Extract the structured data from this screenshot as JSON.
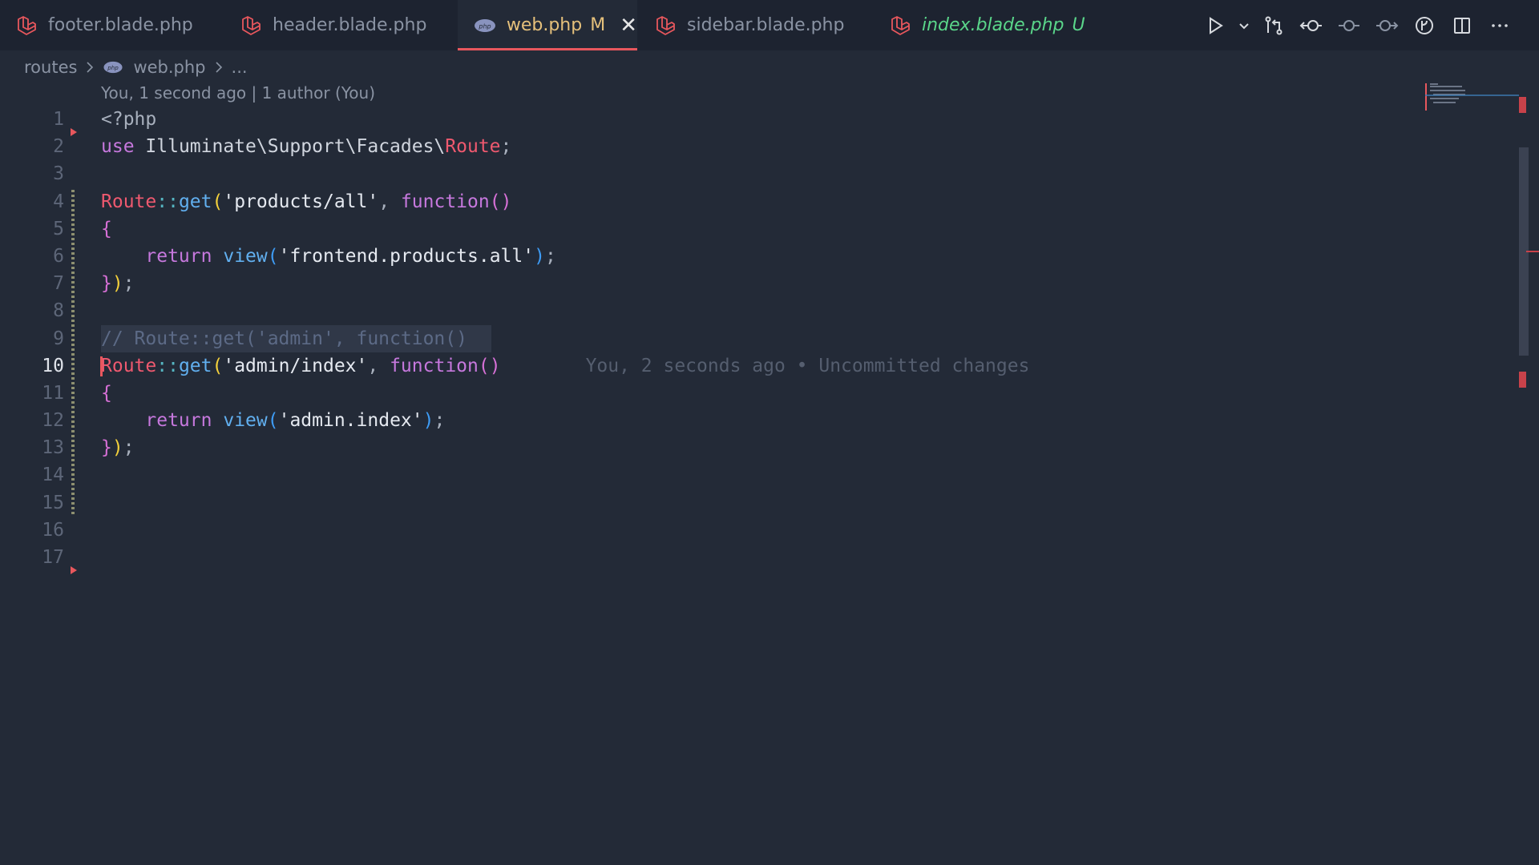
{
  "tabs": [
    {
      "name": "footer.blade.php",
      "status": "",
      "kind": "blade"
    },
    {
      "name": "header.blade.php",
      "status": "",
      "kind": "blade"
    },
    {
      "name": "web.php",
      "status": "M",
      "kind": "php",
      "active": true,
      "close": "✕"
    },
    {
      "name": "sidebar.blade.php",
      "status": "",
      "kind": "blade"
    },
    {
      "name": "index.blade.php",
      "status": "U",
      "kind": "blade"
    }
  ],
  "toolbar": {
    "icons": [
      "run-icon",
      "run-dropdown-icon",
      "source-control-compare-icon",
      "go-back-icon",
      "timeline-icon",
      "go-forward-icon",
      "gitlens-icon",
      "split-editor-icon",
      "more-actions-icon"
    ]
  },
  "breadcrumb": {
    "folder": "routes",
    "file": "web.php",
    "symbol": "..."
  },
  "editor": {
    "blame_header": "You, 1 second ago | 1 author (You)",
    "current_line": 10,
    "line_numbers": [
      "1",
      "2",
      "3",
      "4",
      "5",
      "6",
      "7",
      "8",
      "9",
      "10",
      "11",
      "12",
      "13",
      "14",
      "15",
      "16",
      "17"
    ],
    "code": {
      "l1": "<?php",
      "l2_kw": "use",
      "l2_ns": "Illuminate\\Support\\Facades\\",
      "l2_cls": "Route",
      "l2_end": ";",
      "l4_cls": "Route",
      "l4_op": "::",
      "l4_fn": "get",
      "l4_str": "'products/all'",
      "l4_func": "function",
      "l5": "{",
      "l6_ret": "return",
      "l6_fn": "view",
      "l6_str": "'frontend.products.all'",
      "l7": "});",
      "l9_comment": "// Route::get('admin', function()",
      "l10_cls": "Route",
      "l10_op": "::",
      "l10_fn": "get",
      "l10_str": "'admin/index'",
      "l10_func": "function",
      "l10_blame": "You, 2 seconds ago • Uncommitted changes",
      "l11": "{",
      "l12_ret": "return",
      "l12_fn": "view",
      "l12_str": "'admin.index'",
      "l13": "});"
    }
  },
  "colors": {
    "background": "#232a37",
    "tabbar": "#1d2330",
    "active_tab_border": "#e8575d",
    "modified": "#e5c07b",
    "untracked": "#5ad68a",
    "keyword": "#c678dd",
    "class": "#ef596f",
    "function": "#61afef"
  }
}
